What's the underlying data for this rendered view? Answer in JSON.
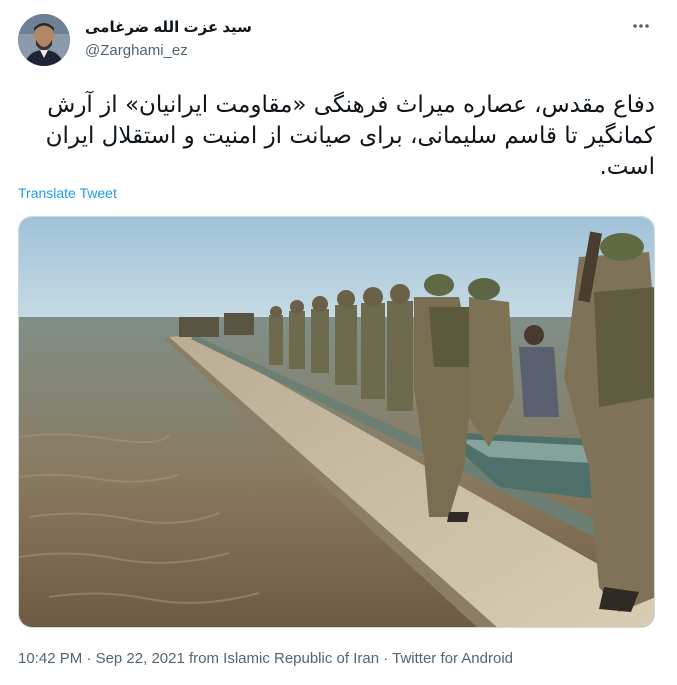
{
  "author": {
    "display_name": "سید عزت الله ضرغامی",
    "handle": "@Zarghami_ez",
    "avatar_icon": "profile-photo"
  },
  "menu_icon": "more-horizontal-icon",
  "tweet": {
    "text": "دفاع مقدس، عصاره میراث فرهنگی «مقاومت ایرانیان» از آرش کمانگیر تا قاسم سلیمانی، برای صیانت از امنیت و استقلال ایران است.",
    "translate_label": "Translate Tweet"
  },
  "media": {
    "type": "photo",
    "description_icon": "soldiers-on-causeway-photo"
  },
  "meta": {
    "time": "10:42 PM",
    "sep1": " · ",
    "date": "Sep 22, 2021",
    "location_text": " from Islamic Republic of Iran",
    "sep2": " · ",
    "source": "Twitter for Android"
  },
  "colors": {
    "link": "#1d9bf0",
    "secondary_text": "#536471",
    "primary_text": "#0f1419"
  }
}
